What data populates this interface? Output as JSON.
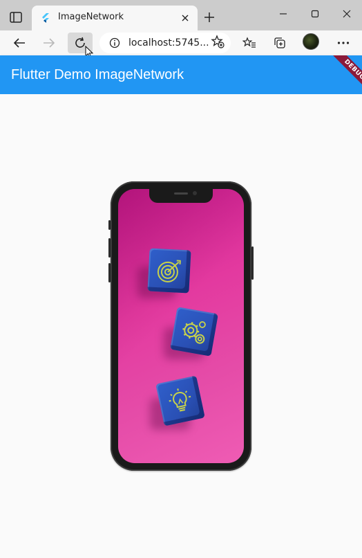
{
  "browser": {
    "tab": {
      "title": "ImageNetwork",
      "favicon": "flutter-logo-icon",
      "close_icon": "close-icon"
    },
    "new_tab_icon": "plus-icon",
    "window_controls": [
      "minimize-icon",
      "maximize-icon",
      "close-icon"
    ],
    "toolbar": {
      "back_icon": "arrow-left-icon",
      "forward_icon": "arrow-right-icon",
      "refresh_icon": "refresh-icon",
      "site_info_icon": "info-icon",
      "url": "localhost:5745...",
      "add_favorite_icon": "star-add-icon",
      "favorites_icon": "favorites-list-icon",
      "collections_icon": "collections-icon",
      "profile_icon": "avatar",
      "menu_icon": "more-icon"
    }
  },
  "app": {
    "appbar_title": "Flutter Demo ImageNetwork",
    "debug_banner": "DEBUG",
    "colors": {
      "appbar": "#2196f3",
      "banner": "#8b1a3a",
      "background": "#fafafa"
    },
    "image": {
      "subject": "phone-mockup",
      "cubes": [
        "target-icon",
        "gears-icon",
        "lightbulb-icon"
      ]
    }
  }
}
